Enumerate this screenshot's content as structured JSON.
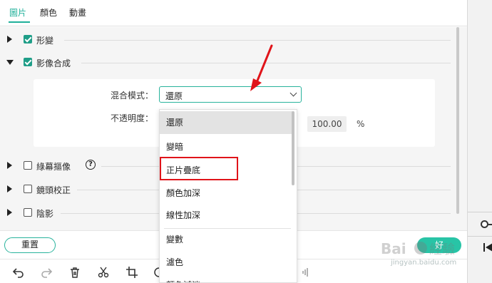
{
  "tabs": [
    {
      "label": "圖片",
      "active": true
    },
    {
      "label": "顏色",
      "active": false
    },
    {
      "label": "動畫",
      "active": false
    }
  ],
  "properties": {
    "transform": {
      "label": "形變",
      "checked": true,
      "expanded": false
    },
    "compositing": {
      "label": "影像合成",
      "checked": true,
      "expanded": true
    },
    "green_screen": {
      "label": "綠幕摳像",
      "checked": false,
      "expanded": false
    },
    "lens_correction": {
      "label": "鏡頭校正",
      "checked": false,
      "expanded": false
    },
    "shadow": {
      "label": "陰影",
      "checked": false,
      "expanded": false
    }
  },
  "blend": {
    "mode_label": "混合模式：",
    "mode_value": "還原",
    "opacity_label": "不透明度：",
    "opacity_value": "100.00",
    "opacity_unit": "%"
  },
  "dropdown": {
    "options": [
      {
        "label": "還原",
        "selected": true
      },
      {
        "label": "變暗",
        "selected": false
      },
      {
        "label": "正片疊底",
        "selected": false,
        "highlighted": true
      },
      {
        "label": "顏色加深",
        "selected": false
      },
      {
        "label": "線性加深",
        "selected": false
      },
      {
        "label": "變數",
        "selected": false
      },
      {
        "label": "濾色",
        "selected": false
      },
      {
        "label": "顏色減淡",
        "selected": false
      }
    ]
  },
  "buttons": {
    "reset": "重置",
    "ok": "好"
  },
  "toolbar": {
    "icons": [
      "undo-icon",
      "redo-icon",
      "delete-icon",
      "cut-icon",
      "crop-icon",
      "speed-icon",
      "audio-icon"
    ]
  },
  "watermark": {
    "logo": "Baidu 經驗",
    "text": "jingyan.baidu.com"
  },
  "colors": {
    "accent": "#28b39c",
    "annotation_red": "#e0141a",
    "panel_bg": "#f5f5f5"
  }
}
